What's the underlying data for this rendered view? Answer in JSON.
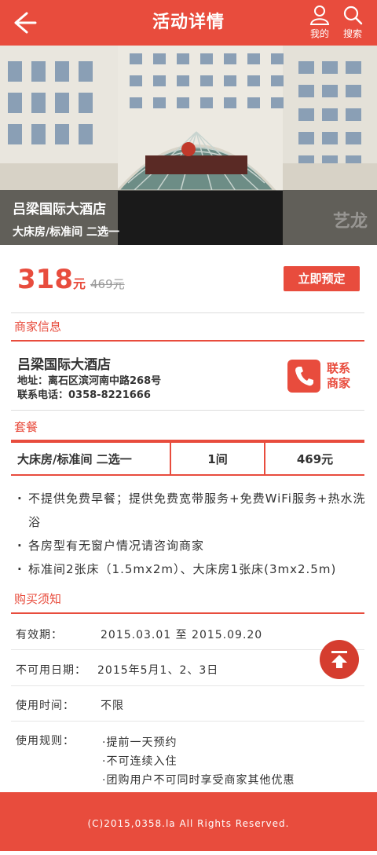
{
  "header": {
    "title": "活动详情",
    "user_label": "我的",
    "search_label": "搜索"
  },
  "hero": {
    "name": "吕梁国际大酒店",
    "subtitle": "大床房/标准间  二选一",
    "watermark": "艺龙"
  },
  "price": {
    "value": "318",
    "unit": "元",
    "original": "469元",
    "book_label": "立即预定"
  },
  "merchant": {
    "section_title": "商家信息",
    "name": "吕梁国际大酒店",
    "address": "地址：离石区滨河南中路268号",
    "phone": "联系电话：0358-8221666",
    "contact_label": "联系商家"
  },
  "package": {
    "section_title": "套餐",
    "row": {
      "name": "大床房/标准间  二选一",
      "qty": "1间",
      "price": "469元"
    },
    "notes": [
      "不提供免费早餐；提供免费宽带服务+免费WiFi服务+热水洗浴",
      "各房型有无窗户情况请咨询商家",
      "标准间2张床（1.5mx2m）、大床房1张床(3mx2.5m)"
    ]
  },
  "purchase": {
    "section_title": "购买须知",
    "validity_label": "有效期：",
    "validity_value": "2015.03.01  至  2015.09.20",
    "unavailable_label": "不可用日期：",
    "unavailable_value": "2015年5月1、2、3日",
    "time_label": "使用时间：",
    "time_value": "不限",
    "rules_label": "使用规则：",
    "rules": [
      "·提前一天预约",
      "·不可连续入住",
      "·团购用户不可同时享受商家其他优惠"
    ]
  },
  "footer": {
    "copyright": "(C)2015,0358.la All Rights Reserved."
  },
  "colors": {
    "accent": "#e84c3d"
  }
}
